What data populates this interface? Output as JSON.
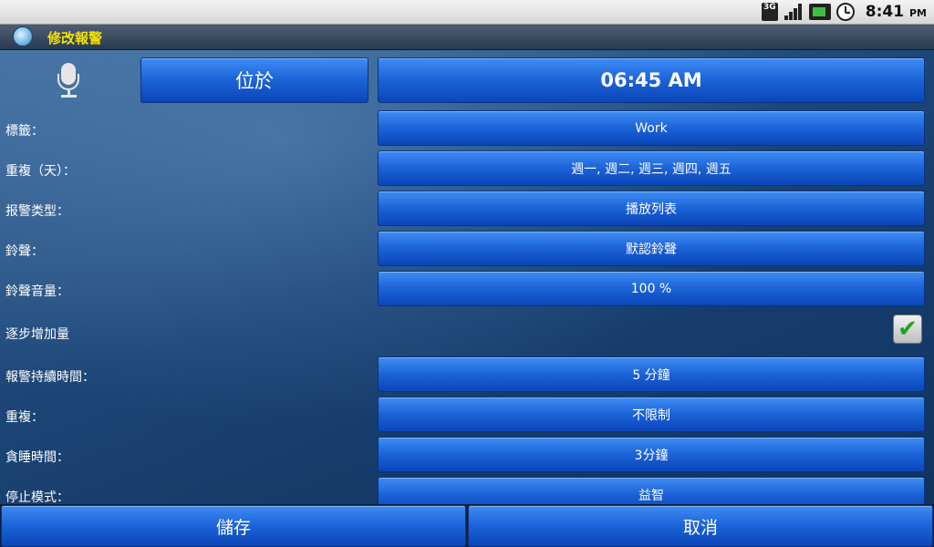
{
  "status_bar": {
    "network": "3G",
    "time": "8:41",
    "ampm": "PM",
    "icons": [
      "3g-icon",
      "signal-icon",
      "battery-icon",
      "alarm-clock-icon"
    ]
  },
  "titlebar": {
    "title": "修改報警",
    "icon": "alarm-clock-icon"
  },
  "top": {
    "location_button": "位於",
    "time_button": "06:45 AM",
    "mic_icon": "microphone-icon"
  },
  "rows": [
    {
      "label": "標籤：",
      "value": "Work"
    },
    {
      "label": "重複（天）：",
      "value": "週一, 週二, 週三, 週四, 週五"
    },
    {
      "label": "报警类型：",
      "value": "播放列表"
    },
    {
      "label": "鈴聲：",
      "value": "默認鈴聲"
    },
    {
      "label": "鈴聲音量：",
      "value": "100 %"
    },
    {
      "label": "逐步增加量",
      "checked": true
    },
    {
      "label": "報警持續時間：",
      "value": "5 分鐘"
    },
    {
      "label": "重複：",
      "value": "不限制"
    },
    {
      "label": "貪睡時間：",
      "value": "3分鐘"
    },
    {
      "label": "停止模式：",
      "value": "益智"
    }
  ],
  "footer": {
    "save": "儲存",
    "cancel": "取消"
  },
  "colors": {
    "title": "#f2e200",
    "button": "#1c62d8",
    "check": "#1fa31f"
  }
}
